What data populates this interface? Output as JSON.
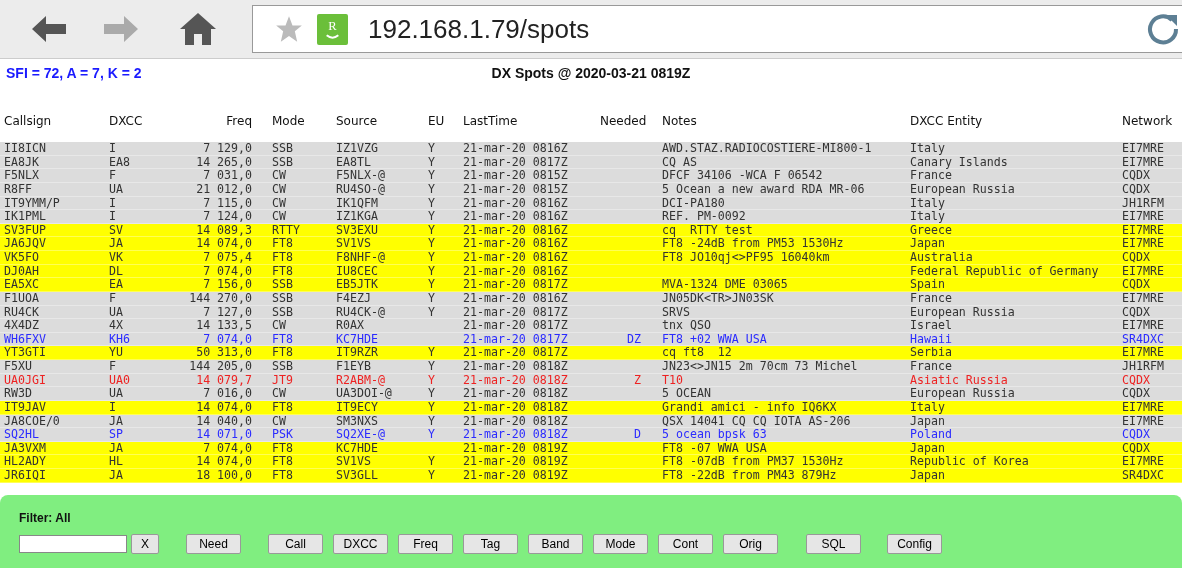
{
  "browser": {
    "url": "192.168.1.79/spots",
    "site_badge": "R"
  },
  "header": {
    "solar": "SFI = 72, A = 7, K = 2",
    "title": "DX Spots @ 2020-03-21 0819Z"
  },
  "table": {
    "columns": [
      "Callsign",
      "DXCC",
      "Freq",
      "Mode",
      "Source",
      "EU",
      "LastTime",
      "Needed",
      "Notes",
      "DXCC Entity",
      "Network"
    ],
    "rows": [
      {
        "callsign": "II8ICN",
        "dxcc": "I",
        "freq": "7 129,0",
        "mode": "SSB",
        "source": "IZ1VZG",
        "eu": "Y",
        "last_time": "21-mar-20 0816Z",
        "notes": "AWD.STAZ.RADIOCOSTIERE-MI800-1",
        "entity": "Italy",
        "network": "EI7MRE",
        "highlighted": false
      },
      {
        "callsign": "EA8JK",
        "dxcc": "EA8",
        "freq": "14 265,0",
        "mode": "SSB",
        "source": "EA8TL",
        "eu": "Y",
        "last_time": "21-mar-20 0817Z",
        "notes": "CQ AS",
        "entity": "Canary Islands",
        "network": "EI7MRE",
        "highlighted": false
      },
      {
        "callsign": "F5NLX",
        "dxcc": "F",
        "freq": "7 031,0",
        "mode": "CW",
        "source": "F5NLX-@",
        "eu": "Y",
        "last_time": "21-mar-20 0815Z",
        "notes": "DFCF 34106 -WCA F 06542",
        "entity": "France",
        "network": "CQDX",
        "highlighted": false
      },
      {
        "callsign": "R8FF",
        "dxcc": "UA",
        "freq": "21 012,0",
        "mode": "CW",
        "source": "RU4SO-@",
        "eu": "Y",
        "last_time": "21-mar-20 0815Z",
        "notes": "5 Ocean a new award RDA MR-06",
        "entity": "European Russia",
        "network": "CQDX",
        "highlighted": false
      },
      {
        "callsign": "IT9YMM/P",
        "dxcc": "I",
        "freq": "7 115,0",
        "mode": "CW",
        "source": "IK1QFM",
        "eu": "Y",
        "last_time": "21-mar-20 0816Z",
        "notes": "DCI-PA180",
        "entity": "Italy",
        "network": "JH1RFM",
        "highlighted": false
      },
      {
        "callsign": "IK1PML",
        "dxcc": "I",
        "freq": "7 124,0",
        "mode": "CW",
        "source": "IZ1KGA",
        "eu": "Y",
        "last_time": "21-mar-20 0816Z",
        "notes": "REF. PM-0092",
        "entity": "Italy",
        "network": "EI7MRE",
        "highlighted": false
      },
      {
        "callsign": "SV3FUP",
        "dxcc": "SV",
        "freq": "14 089,3",
        "mode": "RTTY",
        "source": "SV3EXU",
        "eu": "Y",
        "last_time": "21-mar-20 0816Z",
        "notes": "cq  RTTY test",
        "entity": "Greece",
        "network": "EI7MRE",
        "highlighted": true
      },
      {
        "callsign": "JA6JQV",
        "dxcc": "JA",
        "freq": "14 074,0",
        "mode": "FT8",
        "source": "SV1VS",
        "eu": "Y",
        "last_time": "21-mar-20 0816Z",
        "notes": "FT8 -24dB from PM53 1530Hz",
        "entity": "Japan",
        "network": "EI7MRE",
        "highlighted": true
      },
      {
        "callsign": "VK5FO",
        "dxcc": "VK",
        "freq": "7 075,4",
        "mode": "FT8",
        "source": "F8NHF-@",
        "eu": "Y",
        "last_time": "21-mar-20 0816Z",
        "notes": "FT8 JO10qj<>PF95 16040km",
        "entity": "Australia",
        "network": "CQDX",
        "highlighted": true
      },
      {
        "callsign": "DJ0AH",
        "dxcc": "DL",
        "freq": "7 074,0",
        "mode": "FT8",
        "source": "IU8CEC",
        "eu": "Y",
        "last_time": "21-mar-20 0816Z",
        "entity": "Federal Republic of Germany",
        "network": "EI7MRE",
        "highlighted": true
      },
      {
        "callsign": "EA5XC",
        "dxcc": "EA",
        "freq": "7 156,0",
        "mode": "SSB",
        "source": "EB5JTK",
        "eu": "Y",
        "last_time": "21-mar-20 0817Z",
        "notes": "MVA-1324 DME 03065",
        "entity": "Spain",
        "network": "CQDX",
        "highlighted": true
      },
      {
        "callsign": "F1UOA",
        "dxcc": "F",
        "freq": "144 270,0",
        "mode": "SSB",
        "source": "F4EZJ",
        "eu": "Y",
        "last_time": "21-mar-20 0816Z",
        "notes": "JN05DK<TR>JN03SK",
        "entity": "France",
        "network": "EI7MRE",
        "highlighted": false
      },
      {
        "callsign": "RU4CK",
        "dxcc": "UA",
        "freq": "7 127,0",
        "mode": "SSB",
        "source": "RU4CK-@",
        "eu": "Y",
        "last_time": "21-mar-20 0817Z",
        "notes": "SRVS",
        "entity": "European Russia",
        "network": "CQDX",
        "highlighted": false
      },
      {
        "callsign": "4X4DZ",
        "dxcc": "4X",
        "freq": "14 133,5",
        "mode": "CW",
        "source": "R0AX",
        "last_time": "21-mar-20 0817Z",
        "notes": "tnx QSO",
        "entity": "Israel",
        "network": "EI7MRE",
        "highlighted": false
      },
      {
        "callsign": "WH6FXV",
        "dxcc": "KH6",
        "freq": "7 074,0",
        "mode": "FT8",
        "source": "KC7HDE",
        "last_time": "21-mar-20 0817Z",
        "needed": "DZ",
        "notes": "FT8 +02 WWA USA",
        "entity": "Hawaii",
        "network": "SR4DXC",
        "highlighted": false,
        "color": "#2b2bff"
      },
      {
        "callsign": "YT3GTI",
        "dxcc": "YU",
        "freq": "50 313,0",
        "mode": "FT8",
        "source": "IT9RZR",
        "eu": "Y",
        "last_time": "21-mar-20 0817Z",
        "notes": "cq ft8  12",
        "entity": "Serbia",
        "network": "EI7MRE",
        "highlighted": true
      },
      {
        "callsign": "F5XU",
        "dxcc": "F",
        "freq": "144 205,0",
        "mode": "SSB",
        "source": "F1EYB",
        "eu": "Y",
        "last_time": "21-mar-20 0818Z",
        "notes": "JN23<>JN15 2m 70cm 73 Michel",
        "entity": "France",
        "network": "JH1RFM",
        "highlighted": false
      },
      {
        "callsign": "UA0JGI",
        "dxcc": "UA0",
        "freq": "14 079,7",
        "mode": "JT9",
        "source": "R2ABM-@",
        "eu": "Y",
        "last_time": "21-mar-20 0818Z",
        "needed": "Z",
        "notes": "T10",
        "entity": "Asiatic Russia",
        "network": "CQDX",
        "highlighted": false,
        "color": "#ee2222"
      },
      {
        "callsign": "RW3D",
        "dxcc": "UA",
        "freq": "7 016,0",
        "mode": "CW",
        "source": "UA3DOI-@",
        "eu": "Y",
        "last_time": "21-mar-20 0818Z",
        "notes": "5 OCEAN",
        "entity": "European Russia",
        "network": "CQDX",
        "highlighted": false
      },
      {
        "callsign": "IT9JAV",
        "dxcc": "I",
        "freq": "14 074,0",
        "mode": "FT8",
        "source": "IT9ECY",
        "eu": "Y",
        "last_time": "21-mar-20 0818Z",
        "notes": "Grandi amici - info IQ6KX",
        "entity": "Italy",
        "network": "EI7MRE",
        "highlighted": true
      },
      {
        "callsign": "JA8COE/0",
        "dxcc": "JA",
        "freq": "14 040,0",
        "mode": "CW",
        "source": "SM3NXS",
        "eu": "Y",
        "last_time": "21-mar-20 0818Z",
        "notes": "QSX 14041 CQ CQ IOTA AS-206",
        "entity": "Japan",
        "network": "EI7MRE",
        "highlighted": false
      },
      {
        "callsign": "SQ2HL",
        "dxcc": "SP",
        "freq": "14 071,0",
        "mode": "PSK",
        "source": "SQ2XE-@",
        "eu": "Y",
        "last_time": "21-mar-20 0818Z",
        "needed": "D",
        "notes": "5 ocean bpsk 63",
        "entity": "Poland",
        "network": "CQDX",
        "highlighted": false,
        "color": "#2b2bff"
      },
      {
        "callsign": "JA3VXM",
        "dxcc": "JA",
        "freq": "7 074,0",
        "mode": "FT8",
        "source": "KC7HDE",
        "last_time": "21-mar-20 0819Z",
        "notes": "FT8 -07 WWA USA",
        "entity": "Japan",
        "network": "CQDX",
        "highlighted": true
      },
      {
        "callsign": "HL2ADY",
        "dxcc": "HL",
        "freq": "14 074,0",
        "mode": "FT8",
        "source": "SV1VS",
        "eu": "Y",
        "last_time": "21-mar-20 0819Z",
        "notes": "FT8 -07dB from PM37 1530Hz",
        "entity": "Republic of Korea",
        "network": "EI7MRE",
        "highlighted": true
      },
      {
        "callsign": "JR6IQI",
        "dxcc": "JA",
        "freq": "18 100,0",
        "mode": "FT8",
        "source": "SV3GLL",
        "eu": "Y",
        "last_time": "21-mar-20 0819Z",
        "notes": "FT8 -22dB from PM43 879Hz",
        "entity": "Japan",
        "network": "SR4DXC",
        "highlighted": true
      }
    ]
  },
  "filter_panel": {
    "label": "Filter: All",
    "clear_button": "X",
    "buttons": [
      "Need",
      "Call",
      "DXCC",
      "Freq",
      "Tag",
      "Band",
      "Mode",
      "Cont",
      "Orig",
      "SQL",
      "Config"
    ]
  }
}
